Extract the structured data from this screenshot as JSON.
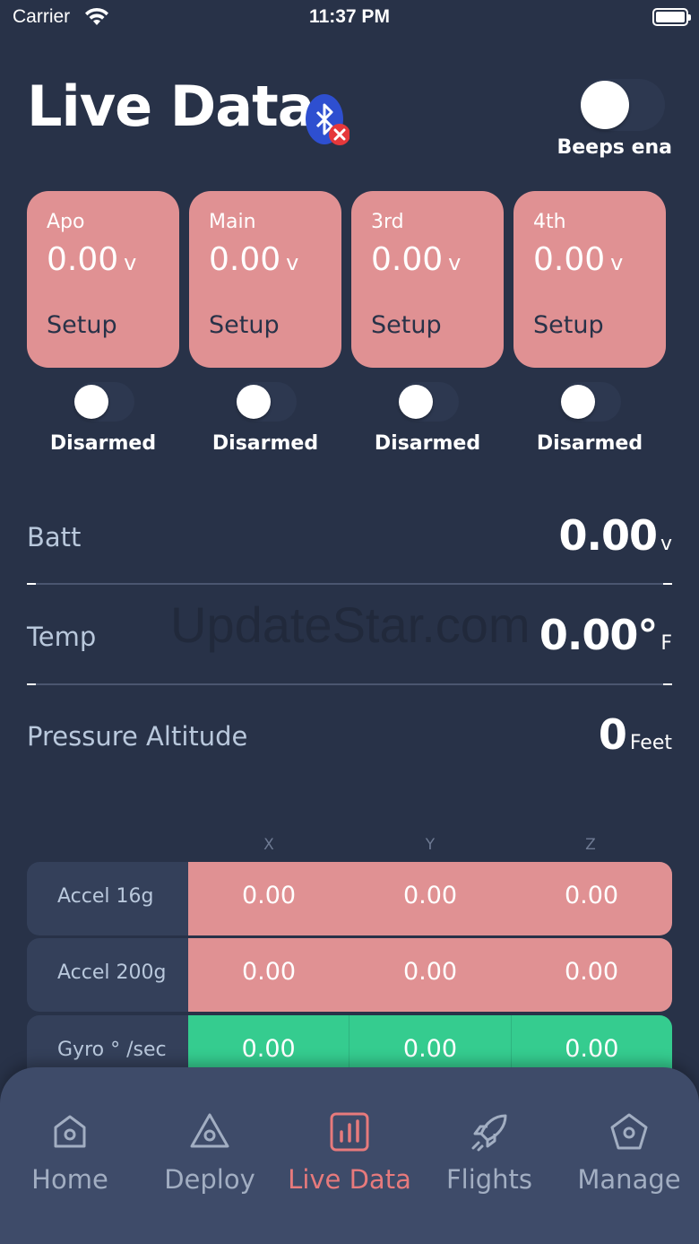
{
  "status_bar": {
    "carrier": "Carrier",
    "time": "11:37 PM",
    "battery_level": 1.0
  },
  "header": {
    "title": "Live Data",
    "bluetooth_icon": "bluetooth-disconnected-icon",
    "beeps_label": "Beeps ena",
    "beeps_enabled": false
  },
  "channels": [
    {
      "name": "Apo",
      "voltage": "0.00",
      "unit": "v",
      "setup_label": "Setup",
      "status": "Disarmed",
      "armed": false
    },
    {
      "name": "Main",
      "voltage": "0.00",
      "unit": "v",
      "setup_label": "Setup",
      "status": "Disarmed",
      "armed": false
    },
    {
      "name": "3rd",
      "voltage": "0.00",
      "unit": "v",
      "setup_label": "Setup",
      "status": "Disarmed",
      "armed": false
    },
    {
      "name": "4th",
      "voltage": "0.00",
      "unit": "v",
      "setup_label": "Setup",
      "status": "Disarmed",
      "armed": false
    }
  ],
  "readings": {
    "batt": {
      "label": "Batt",
      "value": "0.00",
      "unit": "v"
    },
    "temp": {
      "label": "Temp",
      "value": "0.00°",
      "unit": "F"
    },
    "altitude": {
      "label": "Pressure Altitude",
      "value": "0",
      "unit": "Feet"
    },
    "dash": "–"
  },
  "watermark": "UpdateStar.com",
  "sensors": {
    "axes": [
      "X",
      "Y",
      "Z"
    ],
    "rows": [
      {
        "label": "Accel 16g",
        "values": [
          "0.00",
          "0.00",
          "0.00"
        ],
        "color": "#e09193"
      },
      {
        "label": "Accel 200g",
        "values": [
          "0.00",
          "0.00",
          "0.00"
        ],
        "color": "#e09193"
      },
      {
        "label": "Gyro ° /sec",
        "values": [
          "0.00",
          "0.00",
          "0.00"
        ],
        "color": "#35cc8f"
      }
    ]
  },
  "tabs": [
    {
      "label": "Home",
      "icon": "home-icon",
      "active": false
    },
    {
      "label": "Deploy",
      "icon": "deploy-icon",
      "active": false
    },
    {
      "label": "Live Data",
      "icon": "live-data-icon",
      "active": true
    },
    {
      "label": "Flights",
      "icon": "rocket-icon",
      "active": false
    },
    {
      "label": "Manage",
      "icon": "manage-icon",
      "active": false
    }
  ],
  "colors": {
    "background": "#283248",
    "card_red": "#e09193",
    "row_green": "#35cc8f",
    "active_tab": "#e77a7c",
    "inactive_tab": "#a2aec2"
  }
}
